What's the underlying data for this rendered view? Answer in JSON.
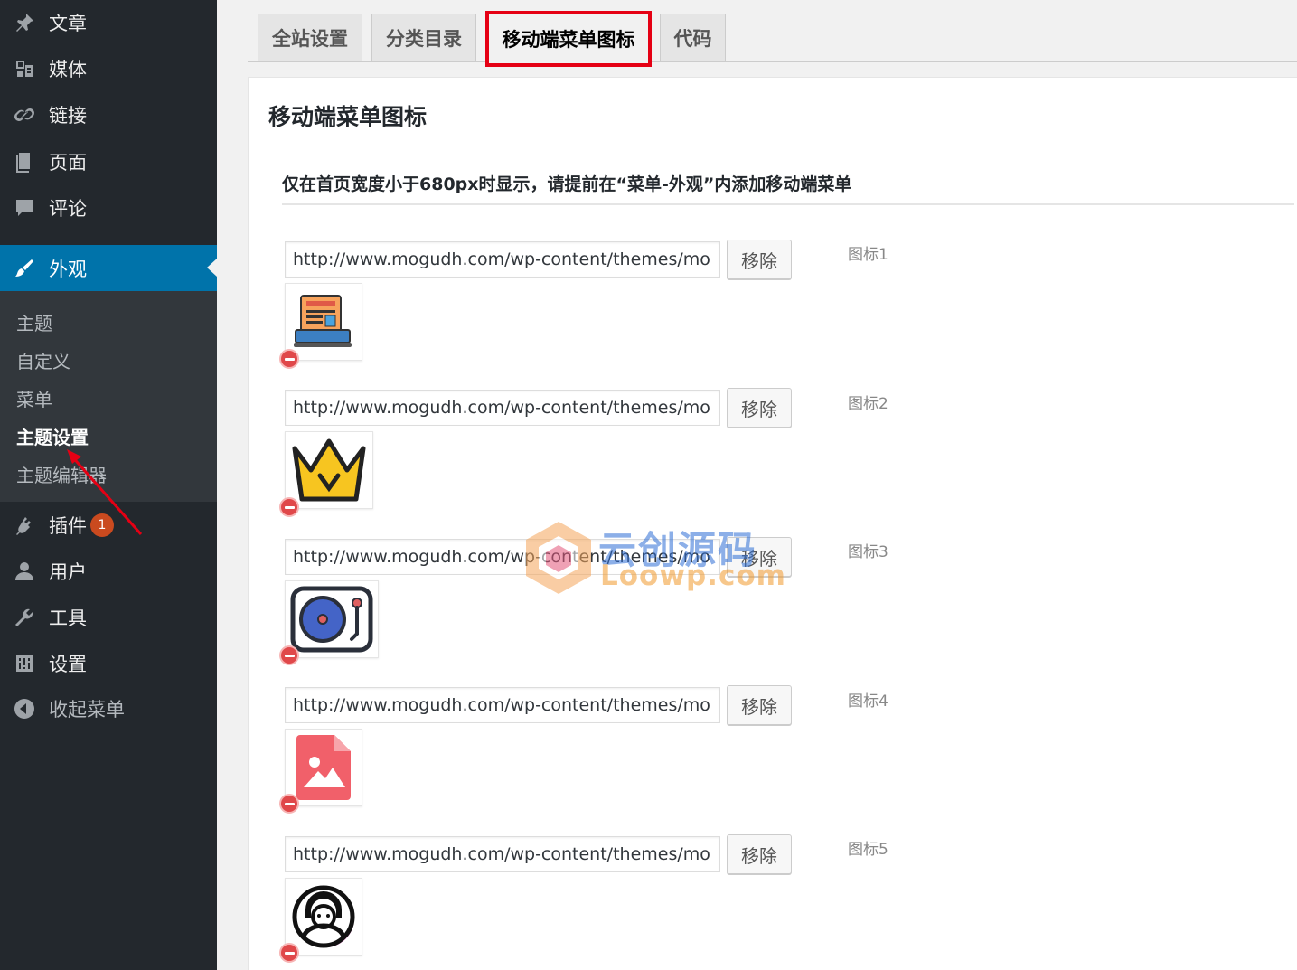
{
  "sidebar": {
    "items": [
      {
        "label": "文章",
        "icon": "pin-icon"
      },
      {
        "label": "媒体",
        "icon": "media-icon"
      },
      {
        "label": "链接",
        "icon": "link-icon"
      },
      {
        "label": "页面",
        "icon": "page-icon"
      },
      {
        "label": "评论",
        "icon": "comment-icon"
      },
      {
        "label": "外观",
        "icon": "brush-icon"
      },
      {
        "label": "插件",
        "icon": "plugin-icon",
        "badge": "1"
      },
      {
        "label": "用户",
        "icon": "user-icon"
      },
      {
        "label": "工具",
        "icon": "wrench-icon"
      },
      {
        "label": "设置",
        "icon": "settings-icon"
      },
      {
        "label": "收起菜单",
        "icon": "collapse-icon"
      }
    ],
    "submenu": [
      "主题",
      "自定义",
      "菜单",
      "主题设置",
      "主题编辑器"
    ]
  },
  "tabs": [
    "全站设置",
    "分类目录",
    "移动端菜单图标",
    "代码"
  ],
  "panel": {
    "title": "移动端菜单图标",
    "notice": "仅在首页宽度小于680px时显示，请提前在“菜单-外观”内添加移动端菜单",
    "rows": [
      {
        "url": "http://www.mogudh.com/wp-content/themes/mo",
        "button": "移除",
        "label": "图标1",
        "image": "news-icon"
      },
      {
        "url": "http://www.mogudh.com/wp-content/themes/mo",
        "button": "移除",
        "label": "图标2",
        "image": "crown-icon"
      },
      {
        "url": "http://www.mogudh.com/wp-content/themes/mo",
        "button": "移除",
        "label": "图标3",
        "image": "turntable-icon"
      },
      {
        "url": "http://www.mogudh.com/wp-content/themes/mo",
        "button": "移除",
        "label": "图标4",
        "image": "image-file-icon"
      },
      {
        "url": "http://www.mogudh.com/wp-content/themes/mo",
        "button": "移除",
        "label": "图标5",
        "image": "avatar-icon"
      }
    ]
  },
  "watermark": {
    "cn": "云创源码",
    "en": "Loowp.com"
  },
  "colors": {
    "sidebar_bg": "#23282d",
    "submenu_bg": "#32373c",
    "active_blue": "#0073aa",
    "highlight_red": "#e50014",
    "badge": "#ca4a1f"
  }
}
